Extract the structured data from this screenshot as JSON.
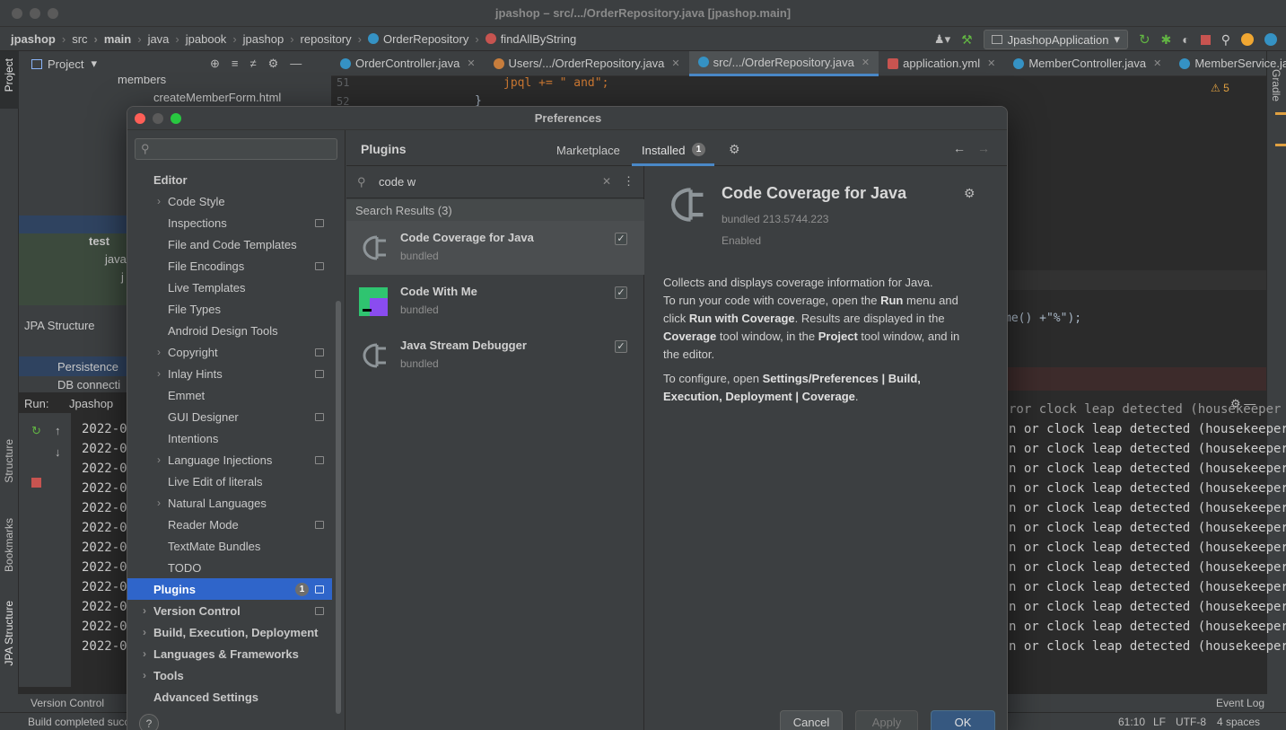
{
  "window": {
    "title": "jpashop – src/.../OrderRepository.java [jpashop.main]"
  },
  "breadcrumbs": [
    "jpashop",
    "src",
    "main",
    "java",
    "jpabook",
    "jpashop",
    "repository",
    "OrderRepository",
    "findAllByString"
  ],
  "run_config": "JpashopApplication",
  "project_panel": {
    "title": "Project",
    "tree": [
      "members",
      "createMemberForm.html",
      "test",
      "java",
      "j"
    ]
  },
  "editor_tabs": [
    {
      "label": "OrderController.java",
      "active": false
    },
    {
      "label": "Users/.../OrderRepository.java",
      "active": false
    },
    {
      "label": "src/.../OrderRepository.java",
      "active": true
    },
    {
      "label": "application.yml",
      "active": false
    },
    {
      "label": "MemberController.java",
      "active": false
    },
    {
      "label": "MemberService.java",
      "active": false
    }
  ],
  "editor": {
    "line_numbers": [
      "51",
      "52"
    ],
    "code_line": "jpql += \" and\";",
    "code_close": "}",
    "warnings": "5",
    "fragment": "me() +\"%\");"
  },
  "jpa_structure": {
    "title": "JPA Structure",
    "items": [
      "Persistence",
      "DB connecti"
    ]
  },
  "run": {
    "label": "Run:",
    "tab": "Jpashop",
    "date_prefix": "2022-01",
    "log_text": "n or clock leap detected (housekeeper",
    "log_first": "ror clock leap detected (housekeeper"
  },
  "left_tools": [
    "Project",
    "Structure",
    "Bookmarks",
    "JPA Structure"
  ],
  "right_tools": [
    "Gradle"
  ],
  "bottom_bar": {
    "version_control": "Version Control",
    "event_log": "Event Log"
  },
  "status": {
    "left": "Build completed succ",
    "position": "61:10",
    "line_sep": "LF",
    "encoding": "UTF-8",
    "indent": "4 spaces"
  },
  "dialog": {
    "title": "Preferences",
    "search_placeholder": "",
    "sidebar": [
      {
        "label": "Editor",
        "level": 0,
        "bold": true
      },
      {
        "label": "Code Style",
        "level": 1,
        "chevron": true
      },
      {
        "label": "Inspections",
        "level": 1,
        "icon": true
      },
      {
        "label": "File and Code Templates",
        "level": 1
      },
      {
        "label": "File Encodings",
        "level": 1,
        "icon": true
      },
      {
        "label": "Live Templates",
        "level": 1
      },
      {
        "label": "File Types",
        "level": 1
      },
      {
        "label": "Android Design Tools",
        "level": 1
      },
      {
        "label": "Copyright",
        "level": 1,
        "chevron": true,
        "icon": true
      },
      {
        "label": "Inlay Hints",
        "level": 1,
        "chevron": true,
        "icon": true
      },
      {
        "label": "Emmet",
        "level": 1
      },
      {
        "label": "GUI Designer",
        "level": 1,
        "icon": true
      },
      {
        "label": "Intentions",
        "level": 1
      },
      {
        "label": "Language Injections",
        "level": 1,
        "chevron": true,
        "icon": true
      },
      {
        "label": "Live Edit of literals",
        "level": 1
      },
      {
        "label": "Natural Languages",
        "level": 1,
        "chevron": true
      },
      {
        "label": "Reader Mode",
        "level": 1,
        "icon": true
      },
      {
        "label": "TextMate Bundles",
        "level": 1
      },
      {
        "label": "TODO",
        "level": 1
      },
      {
        "label": "Plugins",
        "level": 0,
        "bold": true,
        "selected": true,
        "badge": "1",
        "icon": true
      },
      {
        "label": "Version Control",
        "level": 0,
        "bold": true,
        "chevron": true,
        "icon": true
      },
      {
        "label": "Build, Execution, Deployment",
        "level": 0,
        "bold": true,
        "chevron": true
      },
      {
        "label": "Languages & Frameworks",
        "level": 0,
        "bold": true,
        "chevron": true
      },
      {
        "label": "Tools",
        "level": 0,
        "bold": true,
        "chevron": true
      },
      {
        "label": "Advanced Settings",
        "level": 0,
        "bold": true
      }
    ],
    "plugins": {
      "title": "Plugins",
      "tab_marketplace": "Marketplace",
      "tab_installed": "Installed",
      "installed_count": "1",
      "search_value": "code w",
      "results_label": "Search Results (3)",
      "results": [
        {
          "name": "Code Coverage for Java",
          "sub": "bundled",
          "checked": true,
          "selected": true
        },
        {
          "name": "Code With Me",
          "sub": "bundled",
          "checked": true,
          "selected": false
        },
        {
          "name": "Java Stream Debugger",
          "sub": "bundled",
          "checked": true,
          "selected": false
        }
      ],
      "detail": {
        "name": "Code Coverage for Java",
        "version": "bundled 213.5744.223",
        "status": "Enabled",
        "p1_a": "Collects and displays coverage information for Java.",
        "p1_b": "To run your code with coverage, open the ",
        "p1_run": "Run",
        "p1_c": " menu and",
        "p1_d": "click ",
        "p1_runcov": "Run with Coverage",
        "p1_e": ". Results are displayed in the",
        "p1_cov": "Coverage",
        "p1_f": " tool window, in the ",
        "p1_proj": "Project",
        "p1_g": " tool window, and in",
        "p1_h": "the editor.",
        "p2_a": "To configure, open ",
        "p2_b": "Settings/Preferences | Build,",
        "p2_c": "Execution, Deployment | Coverage",
        "p2_d": "."
      }
    },
    "buttons": {
      "help": "?",
      "cancel": "Cancel",
      "apply": "Apply",
      "ok": "OK"
    }
  }
}
